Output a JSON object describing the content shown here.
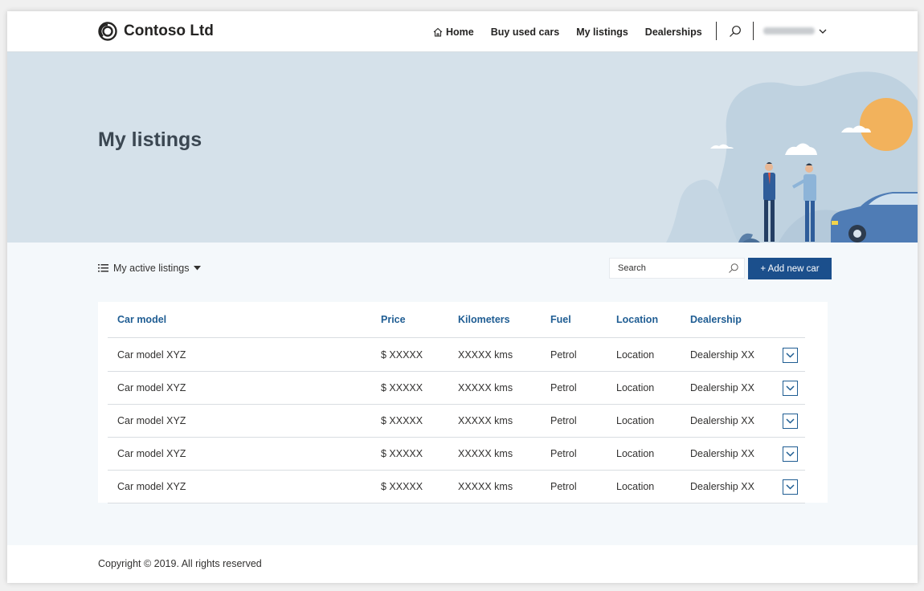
{
  "header": {
    "brand": "Contoso Ltd",
    "nav": [
      {
        "label": "Home",
        "icon": "home-icon"
      },
      {
        "label": "Buy used cars"
      },
      {
        "label": "My listings"
      },
      {
        "label": "Dealerships"
      }
    ],
    "search_icon": "search-icon",
    "user_menu_icon": "chevron-down-icon"
  },
  "hero": {
    "title": "My listings"
  },
  "toolbar": {
    "filter_label": "My active listings",
    "search_placeholder": "Search",
    "add_button_label": "+ Add new car"
  },
  "table": {
    "headers": [
      "Car model",
      "Price",
      "Kilometers",
      "Fuel",
      "Location",
      "Dealership"
    ],
    "rows": [
      [
        "Car model XYZ",
        "$ XXXXX",
        "XXXXX kms",
        "Petrol",
        "Location",
        "Dealership XX"
      ],
      [
        "Car model XYZ",
        "$ XXXXX",
        "XXXXX kms",
        "Petrol",
        "Location",
        "Dealership XX"
      ],
      [
        "Car model XYZ",
        "$ XXXXX",
        "XXXXX kms",
        "Petrol",
        "Location",
        "Dealership XX"
      ],
      [
        "Car model XYZ",
        "$ XXXXX",
        "XXXXX kms",
        "Petrol",
        "Location",
        "Dealership XX"
      ],
      [
        "Car model XYZ",
        "$ XXXXX",
        "XXXXX kms",
        "Petrol",
        "Location",
        "Dealership XX"
      ]
    ]
  },
  "footer": {
    "copyright": "Copyright © 2019. All rights reserved"
  },
  "colors": {
    "accent": "#1b4f8c",
    "header_text": "#1f5d93",
    "hero_bg": "#d5e1ea",
    "page_bg": "#f4f8fb"
  }
}
